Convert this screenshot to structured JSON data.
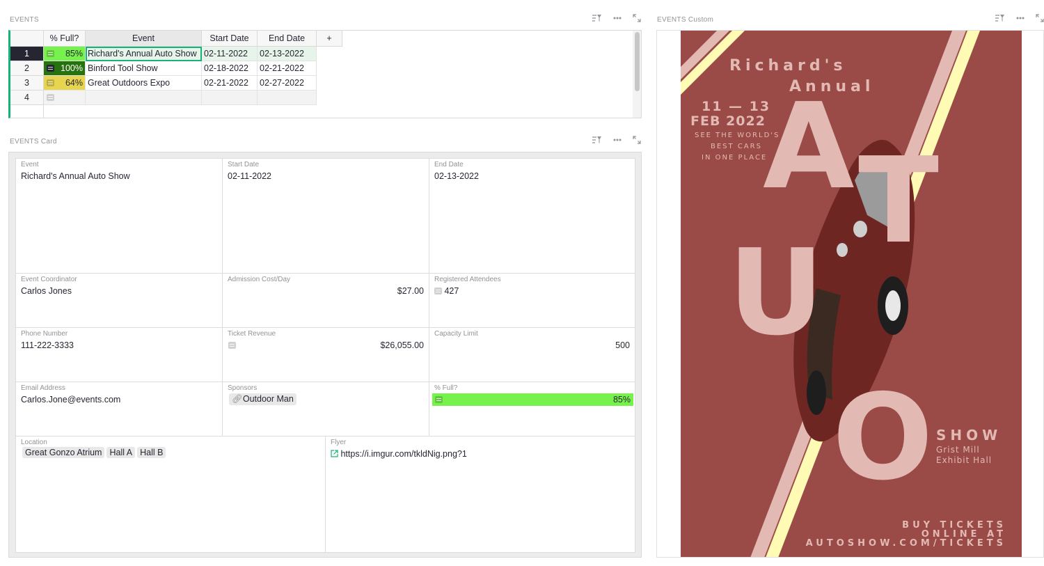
{
  "events_table": {
    "title": "EVENTS",
    "columns": [
      "% Full?",
      "Event",
      "Start Date",
      "End Date"
    ],
    "add_column": "+",
    "rows": [
      {
        "num": "1",
        "pct": "85%",
        "pct_color": "#77f24c",
        "event": "Richard's Annual Auto Show",
        "start": "02-11-2022",
        "end": "02-13-2022"
      },
      {
        "num": "2",
        "pct": "100%",
        "pct_color": "#27710f",
        "event": "Binford Tool Show",
        "start": "02-18-2022",
        "end": "02-21-2022"
      },
      {
        "num": "3",
        "pct": "64%",
        "pct_color": "#e7d54f",
        "event": "Great Outdoors Expo",
        "start": "02-21-2022",
        "end": "02-27-2022"
      },
      {
        "num": "4",
        "pct": "",
        "pct_color": "",
        "event": "",
        "start": "",
        "end": ""
      }
    ]
  },
  "card": {
    "title": "EVENTS Card",
    "event": {
      "label": "Event",
      "value": "Richard's Annual Auto Show"
    },
    "start_date": {
      "label": "Start Date",
      "value": "02-11-2022"
    },
    "end_date": {
      "label": "End Date",
      "value": "02-13-2022"
    },
    "coordinator": {
      "label": "Event Coordinator",
      "value": "Carlos Jones"
    },
    "admission": {
      "label": "Admission Cost/Day",
      "value": "$27.00"
    },
    "attendees": {
      "label": "Registered Attendees",
      "value": "427"
    },
    "phone": {
      "label": "Phone Number",
      "value": "111-222-3333"
    },
    "revenue": {
      "label": "Ticket Revenue",
      "value": "$26,055.00"
    },
    "capacity": {
      "label": "Capacity Limit",
      "value": "500"
    },
    "email": {
      "label": "Email Address",
      "value": "Carlos.Jone@events.com"
    },
    "sponsors": {
      "label": "Sponsors",
      "value": "Outdoor Man"
    },
    "pct_full": {
      "label": "% Full?",
      "value": "85%",
      "fraction": 0.85
    },
    "location": {
      "label": "Location",
      "chips": [
        "Great Gonzo Atrium",
        "Hall A",
        "Hall B"
      ]
    },
    "flyer": {
      "label": "Flyer",
      "url": "https://i.imgur.com/tkldNig.png?1"
    }
  },
  "custom": {
    "title": "EVENTS Custom",
    "poster": {
      "line1": "Richard's",
      "line2": "Annual",
      "dates": "11 — 13",
      "month_year": "FEB 2022",
      "tagline1": "SEE THE WORLD'S",
      "tagline2": "BEST CARS",
      "tagline3": "IN ONE PLACE",
      "big_letters": [
        "A",
        "T",
        "U",
        "O"
      ],
      "show": "SHOW",
      "venue1": "Grist Mill",
      "venue2": "Exhibit Hall",
      "cta1": "BUY TICKETS",
      "cta2": "ONLINE AT",
      "cta3": "AUTOSHOW.COM/TICKETS"
    }
  },
  "colors": {
    "accent": "#16b378",
    "poster_bg": "#9a4a47",
    "poster_text": "#e2b9b3",
    "stripe": "#fffbb4"
  }
}
